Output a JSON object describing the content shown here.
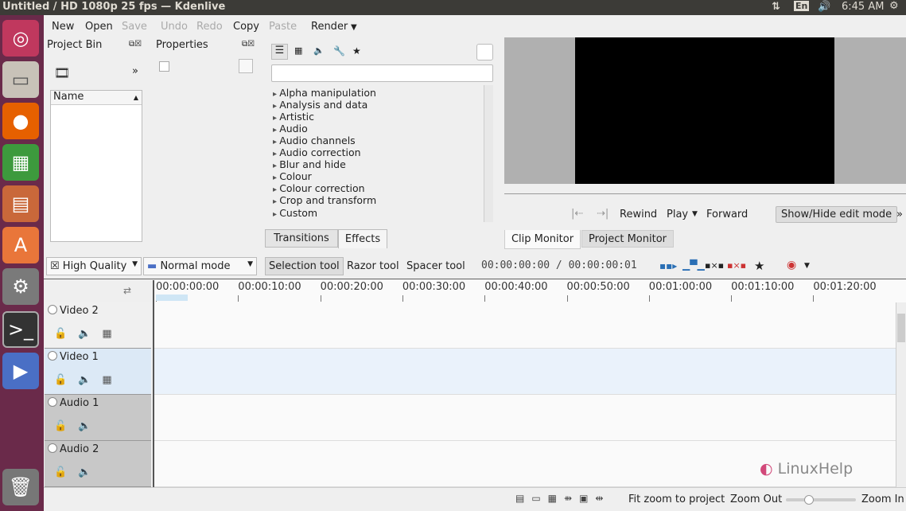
{
  "window_title": "Untitled / HD 1080p 25 fps — Kdenlive",
  "system": {
    "keyboard": "En",
    "time": "6:45 AM"
  },
  "launcher": [
    "ubuntu-logo",
    "files",
    "firefox",
    "spreadsheet",
    "impress",
    "software-center",
    "system-settings",
    "terminal",
    "kdenlive",
    "trash"
  ],
  "toolbar": {
    "new": "New",
    "open": "Open",
    "save": "Save",
    "undo": "Undo",
    "redo": "Redo",
    "copy": "Copy",
    "paste": "Paste",
    "render": "Render"
  },
  "project_bin": {
    "title": "Project Bin",
    "column": "Name"
  },
  "properties": {
    "title": "Properties"
  },
  "effects": {
    "search_value": "",
    "items": [
      "Alpha manipulation",
      "Analysis and data",
      "Artistic",
      "Audio",
      "Audio channels",
      "Audio correction",
      "Blur and hide",
      "Colour",
      "Colour correction",
      "Crop and transform",
      "Custom"
    ],
    "tabs": [
      "Transitions",
      "Effects"
    ]
  },
  "monitor": {
    "rewind": "Rewind",
    "play": "Play",
    "forward": "Forward",
    "edit_mode": "Show/Hide edit mode",
    "tabs": [
      "Clip Monitor",
      "Project Monitor"
    ]
  },
  "timeline_toolbar": {
    "quality": "High Quality",
    "mode": "Normal mode",
    "selection": "Selection tool",
    "razor": "Razor tool",
    "spacer": "Spacer tool",
    "timecode": "00:00:00:00 / 00:00:00:01"
  },
  "ruler": [
    "00:00:00:00",
    "00:00:10:00",
    "00:00:20:00",
    "00:00:30:00",
    "00:00:40:00",
    "00:00:50:00",
    "00:01:00:00",
    "00:01:10:00",
    "00:01:20:00"
  ],
  "tracks": [
    "Video 2",
    "Video 1",
    "Audio 1",
    "Audio 2"
  ],
  "statusbar": {
    "fit": "Fit zoom to project",
    "zoom_out": "Zoom Out",
    "zoom_in": "Zoom In",
    "zoom_level": 0.3
  },
  "watermark": "LinuxHelp"
}
